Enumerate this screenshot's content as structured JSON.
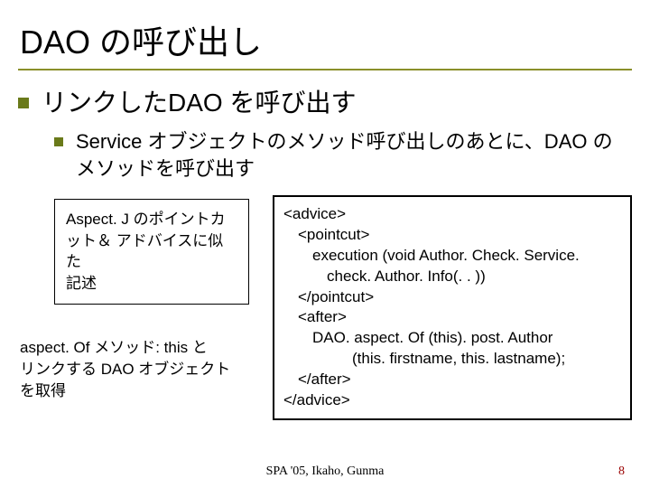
{
  "title": "DAO の呼び出し",
  "bullet1": "リンクしたDAO を呼び出す",
  "bullet2": "Service オブジェクトのメソッド呼び出しのあとに、DAO のメソッドを呼び出す",
  "note_box": {
    "l1": "Aspect. J のポイントカ",
    "l2": "ット＆ アドバイスに似た",
    "l3": "記述"
  },
  "aspect_note": {
    "l1": "aspect. Of メソッド: this と",
    "l2": "リンクする DAO オブジェクト",
    "l3": "を取得"
  },
  "code": {
    "l1": "<advice>",
    "l2": "<pointcut>",
    "l3": "execution (void Author. Check. Service.",
    "l4": "check. Author. Info(. . ))",
    "l5": "</pointcut>",
    "l6": "<after>",
    "l7": "DAO. aspect. Of (this). post. Author",
    "l8": "(this. firstname, this. lastname);",
    "l9": "</after>",
    "l10": "</advice>"
  },
  "footer_center": "SPA '05, Ikaho, Gunma",
  "page_number": "8"
}
